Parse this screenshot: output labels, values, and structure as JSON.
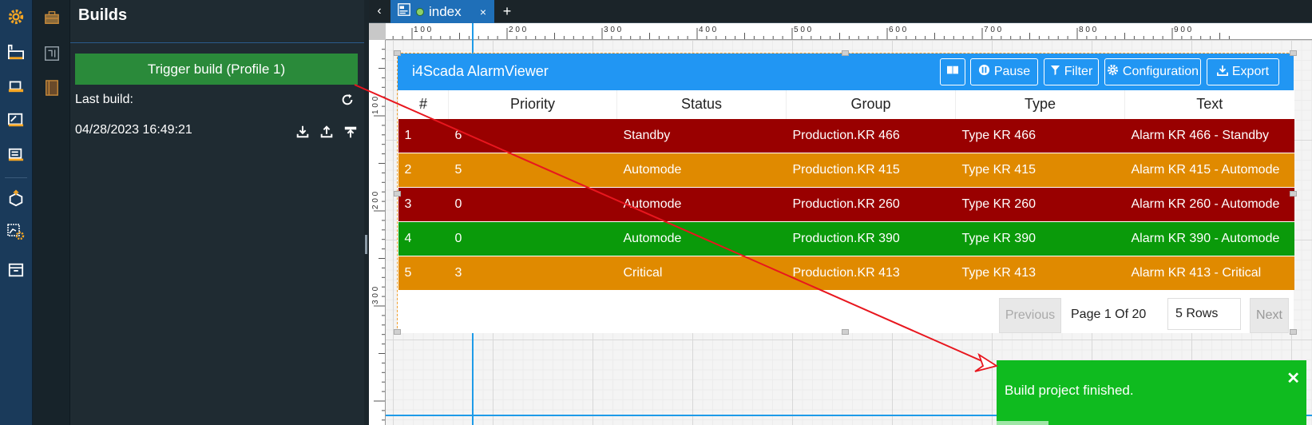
{
  "rail": {
    "icons": [
      "gear-icon",
      "factory-icon",
      "truck-icon",
      "chart-export-icon",
      "server-icon",
      "package-upload-icon",
      "chart-settings-icon",
      "archive-icon"
    ]
  },
  "rail2": {
    "icons": [
      "toolbox-icon",
      "circuit-icon",
      "notebook-icon"
    ]
  },
  "panel": {
    "title": "Builds",
    "trigger_label": "Trigger build (Profile 1)",
    "last_build_label": "Last build:",
    "last_build_date": "04/28/2023 16:49:21"
  },
  "tabs": {
    "active_label": "index",
    "close_label": "×",
    "add_label": "+",
    "back_label": "‹"
  },
  "ruler": {
    "top_labels": [
      "100",
      "200",
      "300",
      "400",
      "500",
      "600",
      "700",
      "800",
      "900"
    ],
    "left_labels": [
      "100",
      "200",
      "300"
    ]
  },
  "alarmviewer": {
    "title": "i4Scada AlarmViewer",
    "buttons": {
      "pause": "Pause",
      "filter": "Filter",
      "configuration": "Configuration",
      "export": "Export"
    },
    "columns": [
      "#",
      "Priority",
      "Status",
      "Group",
      "Type",
      "Text"
    ],
    "rows": [
      {
        "num": "1",
        "priority": "6",
        "status": "Standby",
        "group": "Production.KR 466",
        "type": "Type KR 466",
        "text": "Alarm KR 466 - Standby",
        "color": "red"
      },
      {
        "num": "2",
        "priority": "5",
        "status": "Automode",
        "group": "Production.KR 415",
        "type": "Type KR 415",
        "text": "Alarm KR 415 - Automode",
        "color": "orange"
      },
      {
        "num": "3",
        "priority": "0",
        "status": "Automode",
        "group": "Production.KR 260",
        "type": "Type KR 260",
        "text": "Alarm KR 260 - Automode",
        "color": "red"
      },
      {
        "num": "4",
        "priority": "0",
        "status": "Automode",
        "group": "Production.KR 390",
        "type": "Type KR 390",
        "text": "Alarm KR 390 - Automode",
        "color": "green"
      },
      {
        "num": "5",
        "priority": "3",
        "status": "Critical",
        "group": "Production.KR 413",
        "type": "Type KR 413",
        "text": "Alarm KR 413 - Critical",
        "color": "orange"
      }
    ],
    "pager": {
      "previous": "Previous",
      "page_text": "Page 1 Of 20",
      "rows_select": "5 Rows",
      "next": "Next"
    }
  },
  "toast": {
    "message": "Build project finished.",
    "close_label": "✕"
  },
  "colors": {
    "accent": "#2196f3",
    "row_red": "#990000",
    "row_orange": "#e08a00",
    "row_green": "#0a9a0a",
    "toast": "#0fbb1f",
    "trigger": "#2a8a3a"
  }
}
